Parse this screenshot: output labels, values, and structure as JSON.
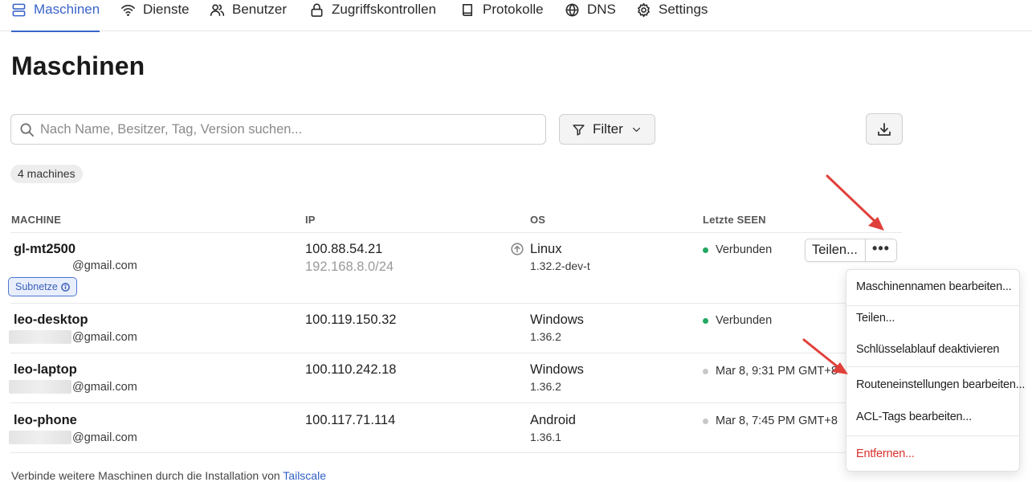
{
  "nav": {
    "items": [
      {
        "label": "Maschinen",
        "icon": "server-icon",
        "active": true
      },
      {
        "label": "Dienste",
        "icon": "wifi-icon"
      },
      {
        "label": "Benutzer",
        "icon": "users-icon"
      },
      {
        "label": "Zugriffskontrollen",
        "icon": "lock-icon"
      },
      {
        "label": "Protokolle",
        "icon": "book-icon"
      },
      {
        "label": "DNS",
        "icon": "globe-icon"
      },
      {
        "label": "Settings",
        "icon": "gear-icon"
      }
    ]
  },
  "page": {
    "title": "Maschinen"
  },
  "search": {
    "placeholder": "Nach Name, Besitzer, Tag, Version suchen..."
  },
  "filter": {
    "label": "Filter"
  },
  "count": {
    "label": "4 machines"
  },
  "table": {
    "headers": {
      "machine": "MACHINE",
      "ip": "IP",
      "os": "OS",
      "seen": "Letzte SEEN"
    },
    "rows": [
      {
        "name": "gl-mt2500",
        "email": "@gmail.com",
        "ip": "100.88.54.21",
        "ip_sub": "192.168.8.0/24",
        "os": "Linux",
        "version": "1.32.2-dev-t",
        "status": "Verbunden",
        "online": true,
        "badge": "Subnetze"
      },
      {
        "name": "leo-desktop",
        "email": "@gmail.com",
        "ip": "100.119.150.32",
        "os": "Windows",
        "version": "1.36.2",
        "status": "Verbunden",
        "online": true
      },
      {
        "name": "leo-laptop",
        "email": "@gmail.com",
        "ip": "100.110.242.18",
        "os": "Windows",
        "version": "1.36.2",
        "status": "Mar 8, 9:31 PM GMT+8",
        "online": false
      },
      {
        "name": "leo-phone",
        "email": "@gmail.com",
        "ip": "100.117.71.114",
        "os": "Android",
        "version": "1.36.1",
        "status": "Mar 8, 7:45 PM GMT+8",
        "online": false
      }
    ]
  },
  "row_actions": {
    "share_label": "Teilen...",
    "more_label": "•••"
  },
  "menu": {
    "items": [
      {
        "label": "Maschinennamen bearbeiten..."
      },
      {
        "label": "Teilen..."
      },
      {
        "label": "Schlüsselablauf deaktivieren"
      },
      {
        "label": "Routeneinstellungen bearbeiten..."
      },
      {
        "label": "ACL-Tags bearbeiten..."
      },
      {
        "label": "Entfernen...",
        "danger": true
      }
    ]
  },
  "footer": {
    "text": "Verbinde weitere Maschinen durch die Installation von",
    "link": "Tailscale"
  },
  "colors": {
    "accent": "#3a64c9",
    "online": "#22a862",
    "danger": "#d9302c",
    "annotation": "#e0403a"
  }
}
